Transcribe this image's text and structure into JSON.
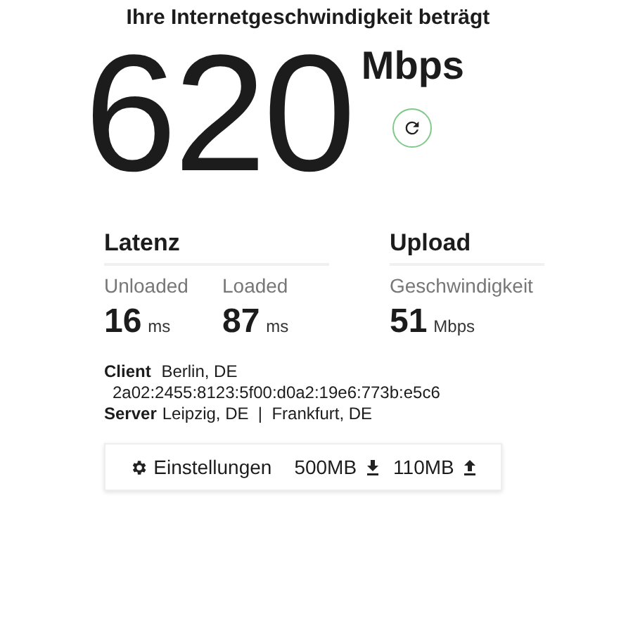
{
  "title": "Ihre Internetgeschwindigkeit beträgt",
  "speed": {
    "value": "620",
    "unit": "Mbps"
  },
  "latency": {
    "heading": "Latenz",
    "metrics": [
      {
        "label": "Unloaded",
        "value": "16",
        "unit": "ms"
      },
      {
        "label": "Loaded",
        "value": "87",
        "unit": "ms"
      }
    ]
  },
  "upload": {
    "heading": "Upload",
    "metrics": [
      {
        "label": "Geschwindigkeit",
        "value": "51",
        "unit": "Mbps"
      }
    ]
  },
  "client": {
    "label": "Client",
    "location": "Berlin, DE",
    "ip": "2a02:2455:8123:5f00:d0a2:19e6:773b:e5c6"
  },
  "server": {
    "label": "Server",
    "locations": "Leipzig, DE  |  Frankfurt, DE"
  },
  "settings_bar": {
    "settings": "Einstellungen",
    "download": "500MB",
    "upload": "110MB"
  }
}
